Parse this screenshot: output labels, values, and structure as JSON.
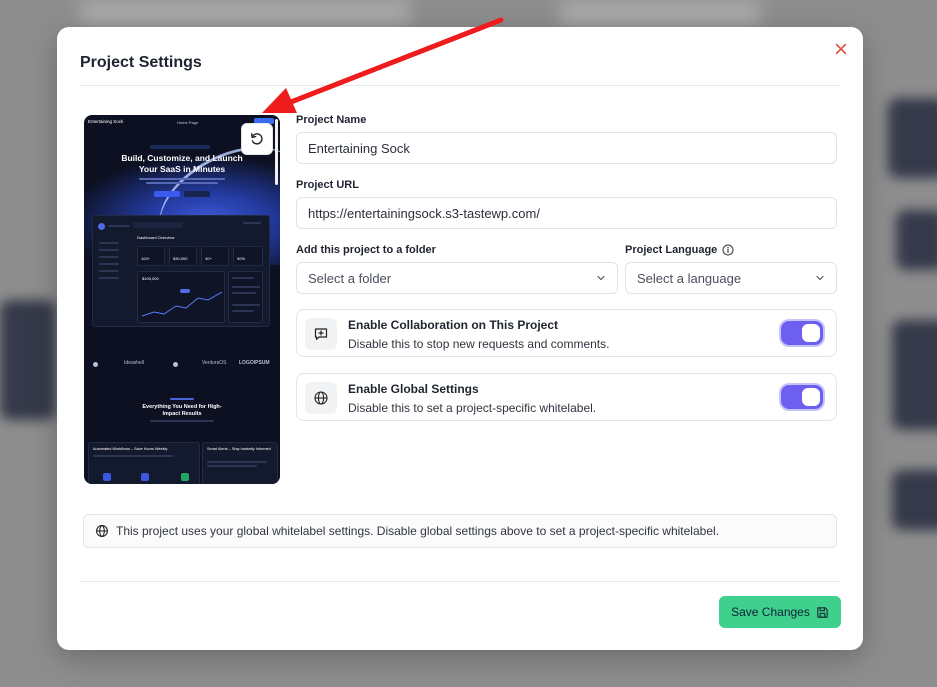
{
  "modal": {
    "title": "Project Settings",
    "close_icon": "close-icon"
  },
  "preview": {
    "site_name": "Entertaining Sock",
    "nav_text": "Home Page",
    "hero_headline_1": "Build, Customize, and Launch",
    "hero_headline_2": "Your SaaS in Minutes",
    "section_headline_1": "Everything You Need for High-",
    "section_headline_2": "Impact Results",
    "dashboard_title": "Dashboard Overview",
    "dashboard_value": "$109,000",
    "stat_1": "100+",
    "stat_2": "$30,000",
    "stat_3": "40+",
    "stat_4": "90%",
    "logo_1": "Ideashell",
    "logo_2": "VenturaOS",
    "logo_3": "LOGOIPSUM",
    "card_1": "Automated Workflows – Save Hours Weekly",
    "card_2": "Smart Alerts – Stay Instantly Informed",
    "refresh_icon": "refresh-icon"
  },
  "form": {
    "project_name": {
      "label": "Project Name",
      "value": "Entertaining Sock"
    },
    "project_url": {
      "label": "Project URL",
      "value": "https://entertainingsock.s3-tastewp.com/"
    },
    "folder": {
      "label": "Add this project to a folder",
      "value": "Select a folder"
    },
    "language": {
      "label": "Project Language",
      "value": "Select a language"
    }
  },
  "toggles": [
    {
      "title": "Enable Collaboration on This Project",
      "description": "Disable this to stop new requests and comments.",
      "icon": "message-plus-icon",
      "enabled": true
    },
    {
      "title": "Enable Global Settings",
      "description": "Disable this to set a project-specific whitelabel.",
      "icon": "globe-icon",
      "enabled": true
    }
  ],
  "info": {
    "text": "This project uses your global whitelabel settings. Disable global settings above to set a project-specific whitelabel.",
    "icon": "globe-icon"
  },
  "footer": {
    "save_label": "Save Changes",
    "save_icon": "save-icon"
  },
  "colors": {
    "accent_toggle": "#6d5ff0",
    "save_button": "#3fd08d",
    "close_icon": "#e2533f",
    "annotation_arrow": "#ee1c1c"
  }
}
